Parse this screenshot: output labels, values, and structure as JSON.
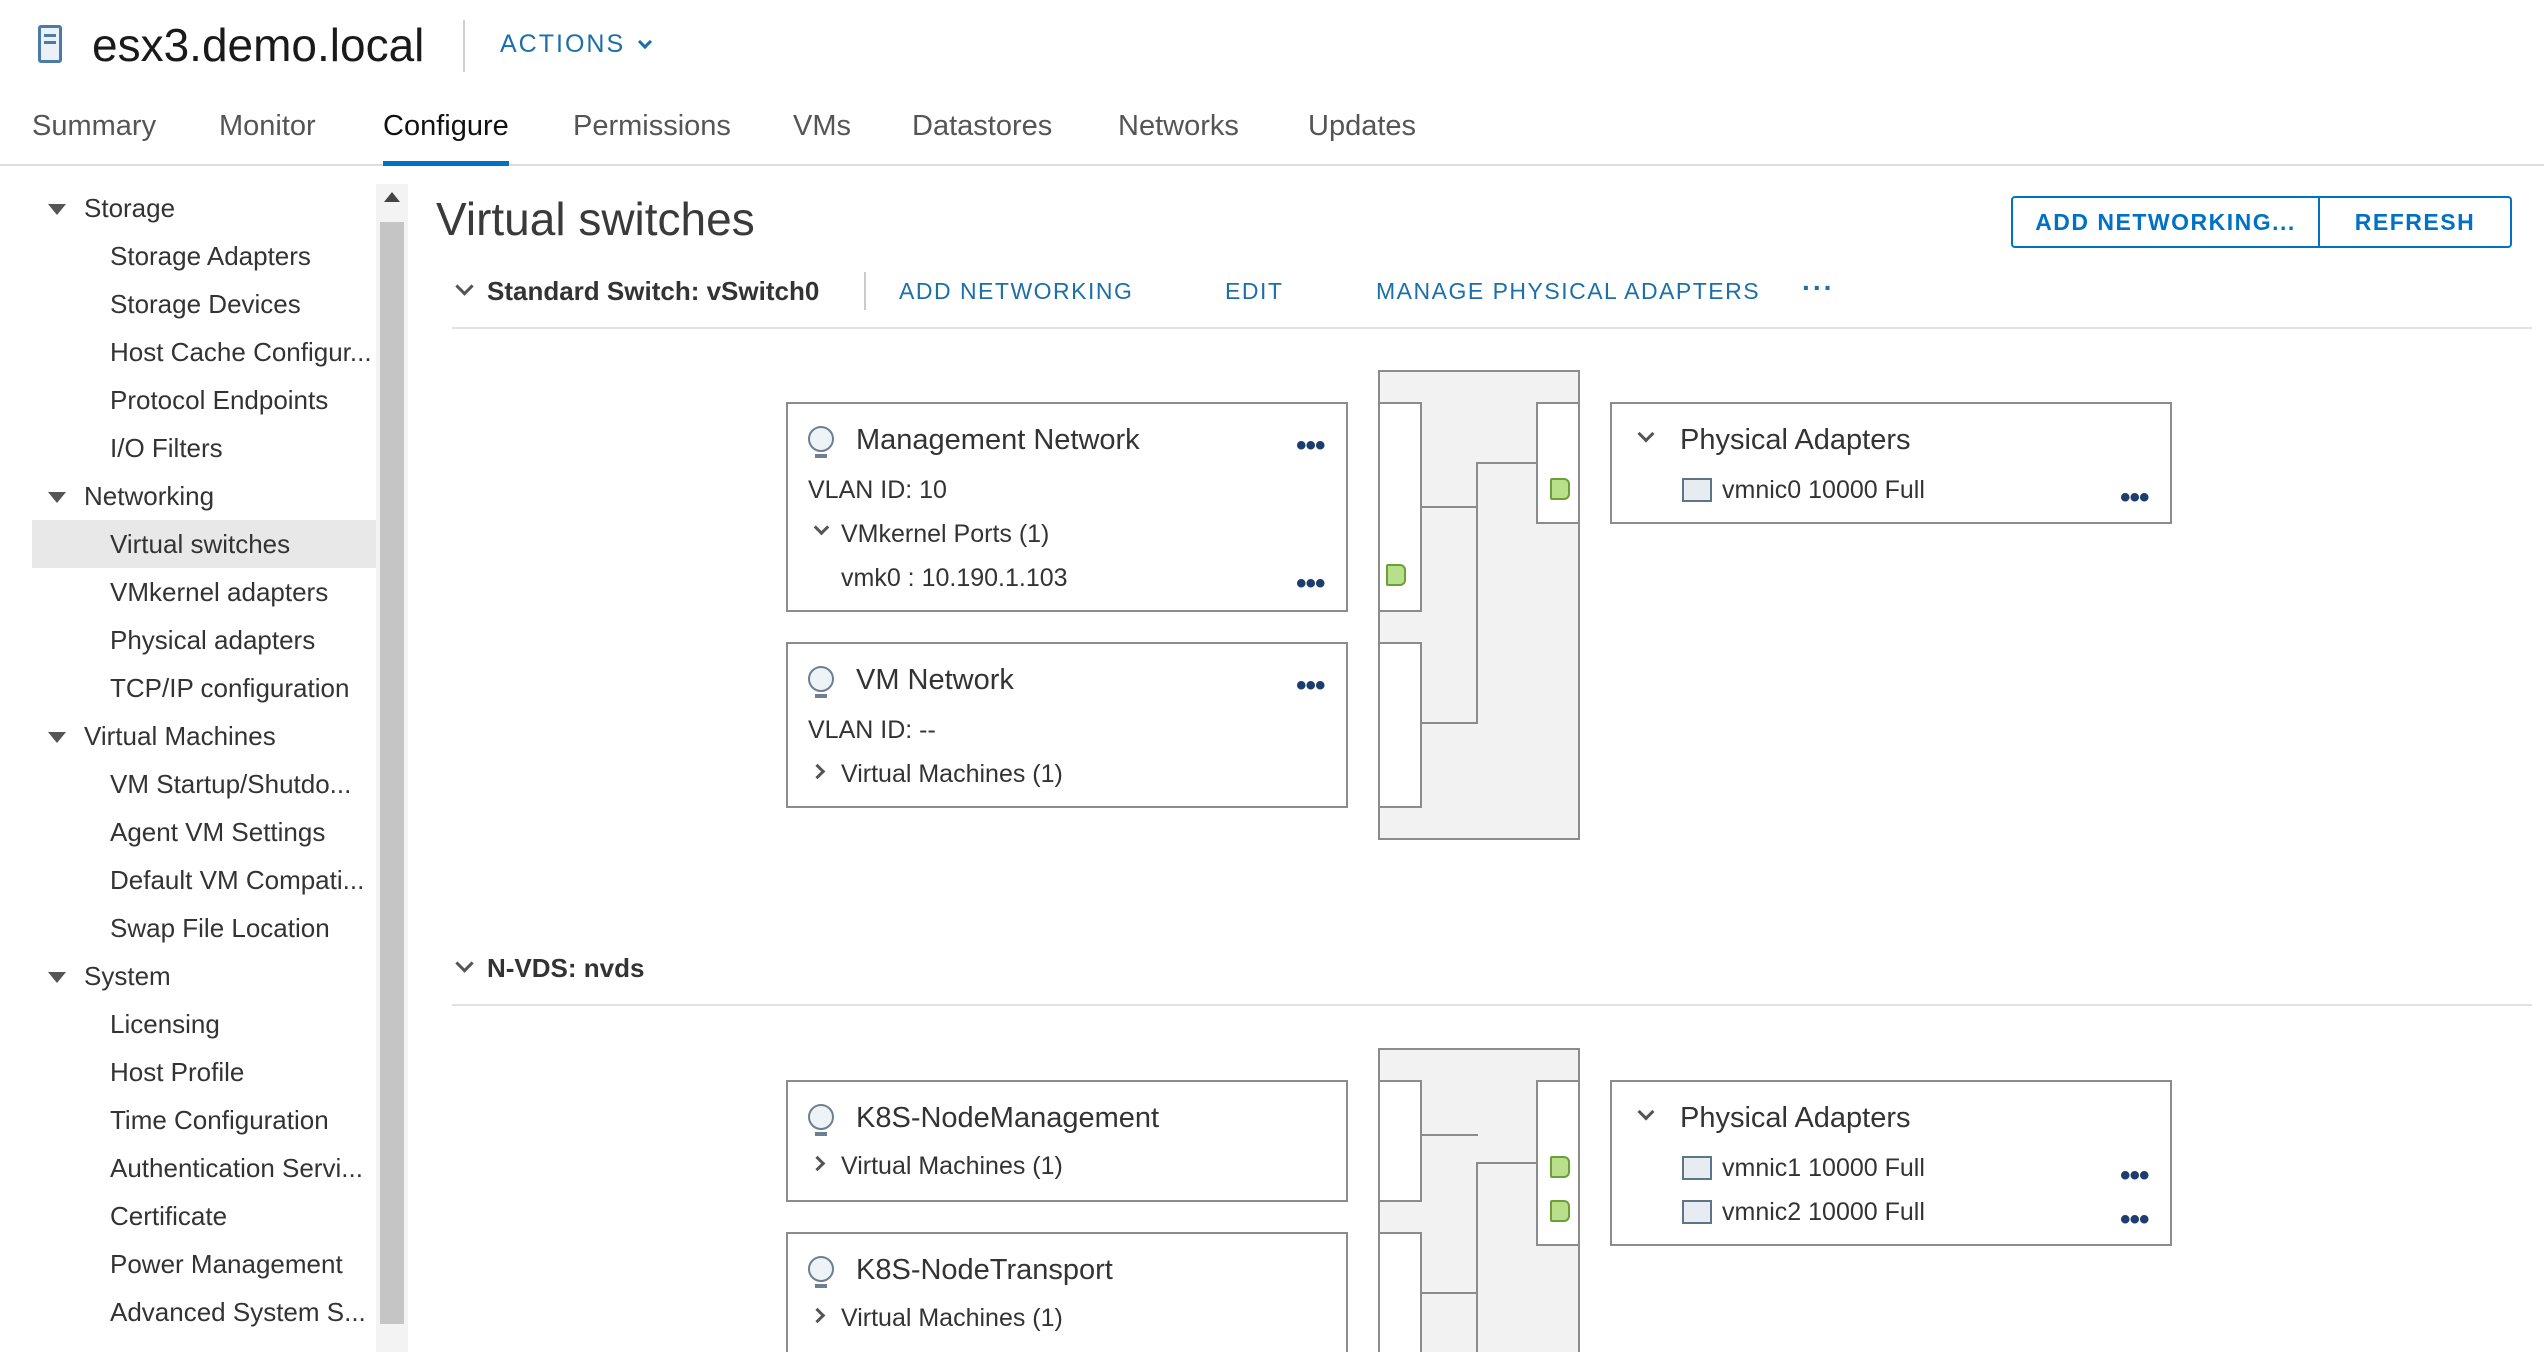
{
  "header": {
    "title": "esx3.demo.local",
    "actions_label": "ACTIONS",
    "tabs": [
      "Summary",
      "Monitor",
      "Configure",
      "Permissions",
      "VMs",
      "Datastores",
      "Networks",
      "Updates"
    ],
    "active_tab": "Configure"
  },
  "sidebar": {
    "items": [
      {
        "label": "Storage",
        "type": "group"
      },
      {
        "label": "Storage Adapters",
        "type": "child"
      },
      {
        "label": "Storage Devices",
        "type": "child"
      },
      {
        "label": "Host Cache Configur...",
        "type": "child"
      },
      {
        "label": "Protocol Endpoints",
        "type": "child"
      },
      {
        "label": "I/O Filters",
        "type": "child"
      },
      {
        "label": "Networking",
        "type": "group"
      },
      {
        "label": "Virtual switches",
        "type": "child",
        "selected": true
      },
      {
        "label": "VMkernel adapters",
        "type": "child"
      },
      {
        "label": "Physical adapters",
        "type": "child"
      },
      {
        "label": "TCP/IP configuration",
        "type": "child"
      },
      {
        "label": "Virtual Machines",
        "type": "group"
      },
      {
        "label": "VM Startup/Shutdo...",
        "type": "child"
      },
      {
        "label": "Agent VM Settings",
        "type": "child"
      },
      {
        "label": "Default VM Compati...",
        "type": "child"
      },
      {
        "label": "Swap File Location",
        "type": "child"
      },
      {
        "label": "System",
        "type": "group"
      },
      {
        "label": "Licensing",
        "type": "child"
      },
      {
        "label": "Host Profile",
        "type": "child"
      },
      {
        "label": "Time Configuration",
        "type": "child"
      },
      {
        "label": "Authentication Servi...",
        "type": "child"
      },
      {
        "label": "Certificate",
        "type": "child"
      },
      {
        "label": "Power Management",
        "type": "child"
      },
      {
        "label": "Advanced System S...",
        "type": "child"
      }
    ]
  },
  "main": {
    "title": "Virtual switches",
    "add_networking_button": "ADD NETWORKING...",
    "refresh_button": "REFRESH",
    "switch1": {
      "label": "Standard Switch: vSwitch0",
      "add_networking": "ADD NETWORKING",
      "edit": "EDIT",
      "manage_adapters": "MANAGE PHYSICAL ADAPTERS",
      "more": "···",
      "pg1": {
        "name": "Management Network",
        "vlan": "VLAN ID: 10",
        "ports_label": "VMkernel Ports (1)",
        "port": "vmk0 : 10.190.1.103"
      },
      "pg2": {
        "name": "VM Network",
        "vlan": "VLAN ID: --",
        "vms_label": "Virtual Machines (1)"
      },
      "adapters_title": "Physical Adapters",
      "nics": [
        "vmnic0 10000 Full"
      ]
    },
    "switch2": {
      "label": "N-VDS: nvds",
      "pg1": {
        "name": "K8S-NodeManagement",
        "vms_label": "Virtual Machines (1)"
      },
      "pg2": {
        "name": "K8S-NodeTransport",
        "vms_label": "Virtual Machines (1)"
      },
      "adapters_title": "Physical Adapters",
      "nics": [
        "vmnic1 10000 Full",
        "vmnic2 10000 Full"
      ]
    }
  },
  "colors": {
    "accent": "#0072c6",
    "link": "#1c6fa8",
    "port_green": "#b8df8a"
  }
}
